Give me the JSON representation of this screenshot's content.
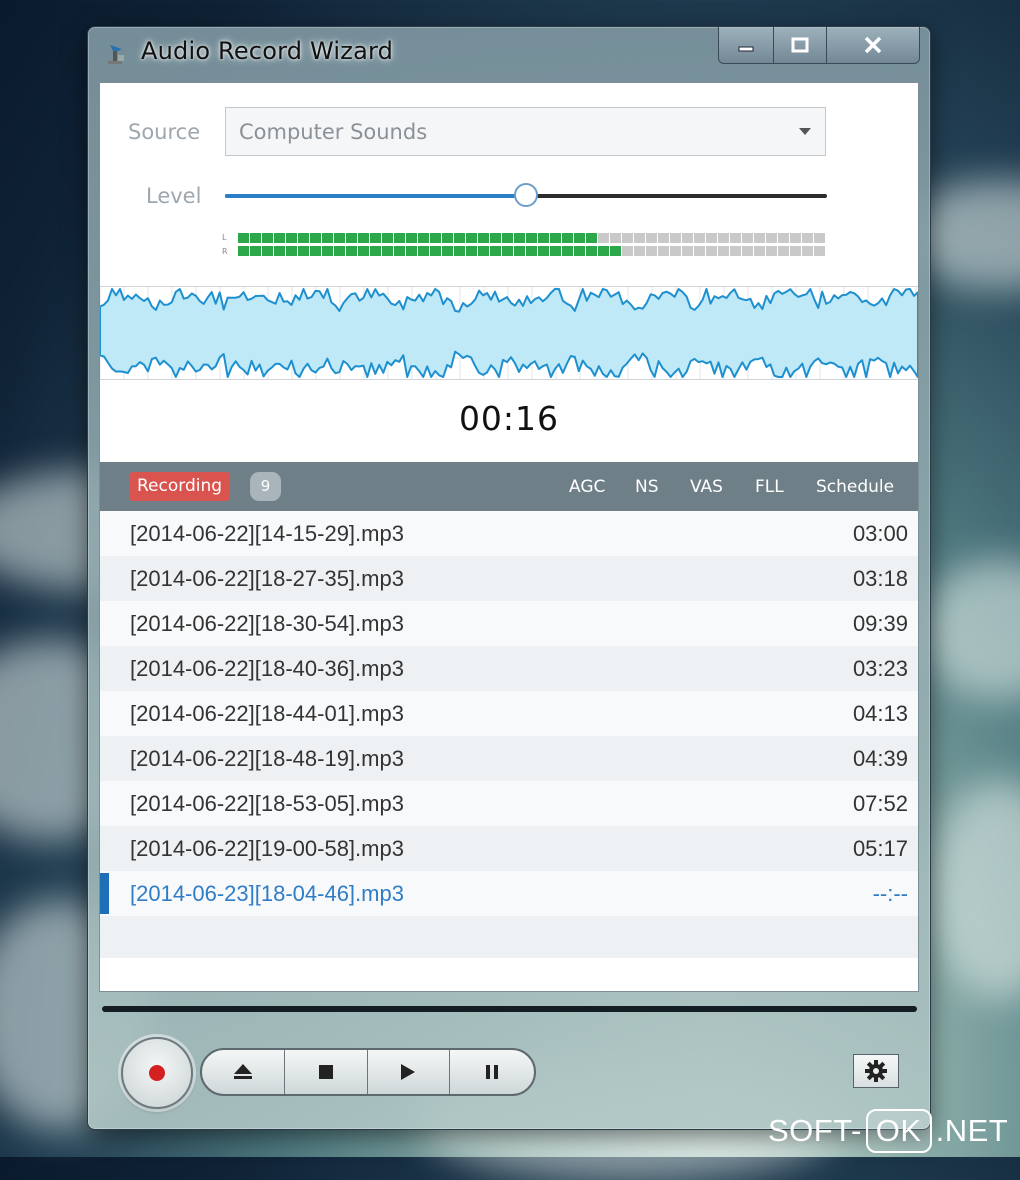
{
  "window": {
    "title": "Audio Record Wizard",
    "controls": {
      "minimize": "minimize-icon",
      "maximize": "maximize-icon",
      "close": "close-icon"
    }
  },
  "source": {
    "label": "Source",
    "value": "Computer Sounds"
  },
  "level": {
    "label": "Level",
    "value_percent": 50
  },
  "meter": {
    "channels": [
      "L",
      "R"
    ],
    "left_percent": 62,
    "right_percent": 66
  },
  "timer": "00:16",
  "list_header": {
    "status": "Recording",
    "count": "9",
    "options": [
      "AGC",
      "NS",
      "VAS",
      "FLL",
      "Schedule"
    ]
  },
  "recordings": [
    {
      "name": "[2014-06-22][14-15-29].mp3",
      "duration": "03:00"
    },
    {
      "name": "[2014-06-22][18-27-35].mp3",
      "duration": "03:18"
    },
    {
      "name": "[2014-06-22][18-30-54].mp3",
      "duration": "09:39"
    },
    {
      "name": "[2014-06-22][18-40-36].mp3",
      "duration": "03:23"
    },
    {
      "name": "[2014-06-22][18-44-01].mp3",
      "duration": "04:13"
    },
    {
      "name": "[2014-06-22][18-48-19].mp3",
      "duration": "04:39"
    },
    {
      "name": "[2014-06-22][18-53-05].mp3",
      "duration": "07:52"
    },
    {
      "name": "[2014-06-22][19-00-58].mp3",
      "duration": "05:17"
    },
    {
      "name": "[2014-06-23][18-04-46].mp3",
      "duration": "--:--",
      "active": true
    }
  ],
  "transport": {
    "record": "record-icon",
    "buttons": [
      "eject-icon",
      "stop-icon",
      "play-icon",
      "pause-icon"
    ],
    "settings": "gear-icon"
  },
  "colors": {
    "accent": "#2a7fc8",
    "record": "#d42020",
    "badge_recording": "#d9544f",
    "meter_on": "#2ca84a",
    "meter_off": "#c9c9c9",
    "wave_fill": "#bfe9f7",
    "wave_stroke": "#1e90cf"
  },
  "watermark": {
    "left": "SOFT-",
    "middle": "OK",
    "right": ".NET"
  }
}
